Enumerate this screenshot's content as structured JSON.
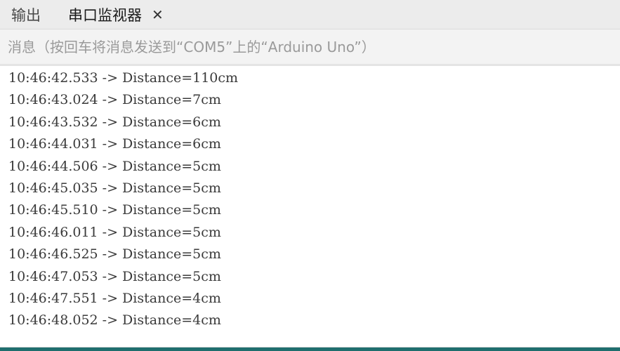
{
  "tabs": {
    "output_label": "输出",
    "serial_monitor_label": "串口监视器",
    "close_glyph": "✕",
    "close_icon": "close-icon"
  },
  "message_input": {
    "placeholder": "消息（按回车将消息发送到“COM5”上的“Arduino Uno”）",
    "value": ""
  },
  "log_lines": [
    "10:46:42.533 -> Distance=110cm",
    "10:46:43.024 -> Distance=7cm",
    "10:46:43.532 -> Distance=6cm",
    "10:46:44.031 -> Distance=6cm",
    "10:46:44.506 -> Distance=5cm",
    "10:46:45.035 -> Distance=5cm",
    "10:46:45.510 -> Distance=5cm",
    "10:46:46.011 -> Distance=5cm",
    "10:46:46.525 -> Distance=5cm",
    "10:46:47.053 -> Distance=5cm",
    "10:46:47.551 -> Distance=4cm",
    "10:46:48.052 -> Distance=4cm"
  ],
  "colors": {
    "tabbar_bg": "#ececec",
    "input_bg": "#f3f3f3",
    "status_bar": "#1f6e6e"
  }
}
